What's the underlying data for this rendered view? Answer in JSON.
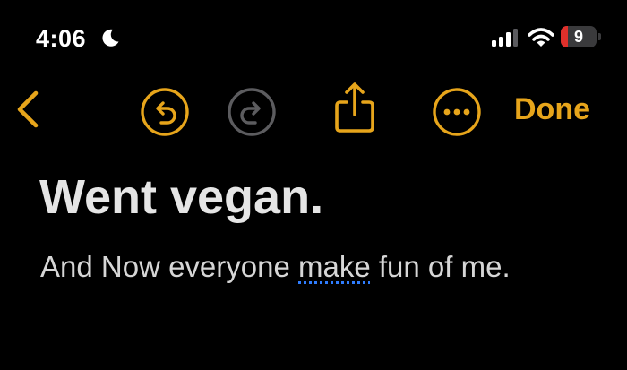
{
  "status_bar": {
    "time": "4:06",
    "moon_icon": "moon-icon",
    "signal_icon": "cellular-signal-icon",
    "wifi_icon": "wifi-icon",
    "battery_level": "9",
    "battery_fraction": 0.09,
    "battery_color": "#e0302b"
  },
  "toolbar": {
    "accent_color": "#e7a51b",
    "back_icon": "chevron-left-icon",
    "undo_icon": "undo-icon",
    "redo_icon": "redo-icon",
    "share_icon": "share-icon",
    "more_icon": "more-options-icon",
    "done_label": "Done"
  },
  "note": {
    "title": "Went vegan.",
    "body_before": "And Now everyone ",
    "body_misspelled": "make",
    "body_after": " fun of me."
  }
}
